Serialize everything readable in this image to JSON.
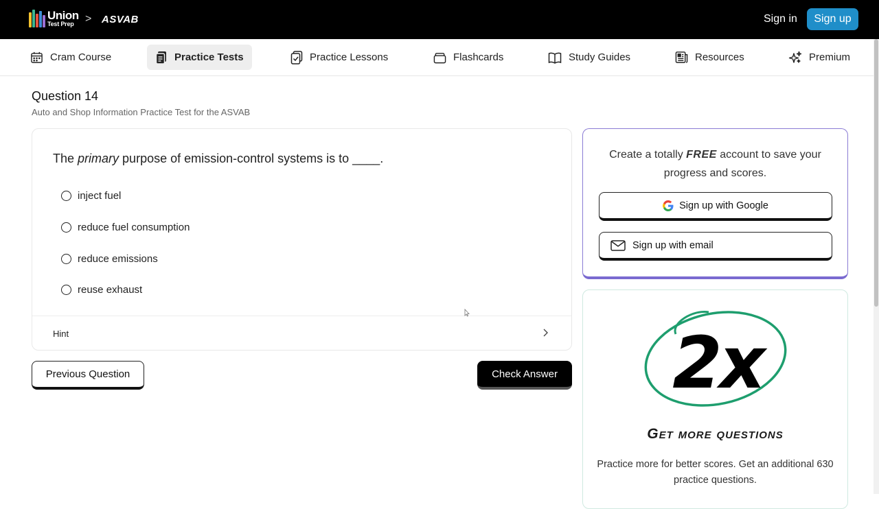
{
  "header": {
    "brand_line1": "Union",
    "brand_line2": "Test Prep",
    "breadcrumb_separator": ">",
    "breadcrumb": "ASVAB",
    "signin_label": "Sign in",
    "signup_label": "Sign up"
  },
  "nav": {
    "items": [
      {
        "label": "Cram Course",
        "icon": "calendar-icon"
      },
      {
        "label": "Practice Tests",
        "icon": "document-stack-icon",
        "active": true
      },
      {
        "label": "Practice Lessons",
        "icon": "clipboard-check-icon"
      },
      {
        "label": "Flashcards",
        "icon": "cards-icon"
      },
      {
        "label": "Study Guides",
        "icon": "open-book-icon"
      },
      {
        "label": "Resources",
        "icon": "newspaper-icon"
      },
      {
        "label": "Premium",
        "icon": "sparkles-icon"
      }
    ]
  },
  "question": {
    "title": "Question 14",
    "subtitle": "Auto and Shop Information Practice Test for the ASVAB",
    "prompt_before": "The ",
    "prompt_emphasis": "primary",
    "prompt_after": " purpose of emission-control systems is to ____.",
    "options": [
      "inject fuel",
      "reduce fuel consumption",
      "reduce emissions",
      "reuse exhaust"
    ],
    "hint_label": "Hint"
  },
  "actions": {
    "previous_label": "Previous Question",
    "check_label": "Check Answer"
  },
  "signup_card": {
    "text_before": "Create a totally ",
    "text_emphasis": "FREE",
    "text_after": " account to save your progress and scores.",
    "google_label": "Sign up with Google",
    "email_label": "Sign up with email"
  },
  "more_card": {
    "badge": "2x",
    "title": "Get more questions",
    "text": "Practice more for better scores. Get an additional 630 practice questions."
  },
  "colors": {
    "accent_blue": "#1f8ec9",
    "promo_border": "#7a6ad0",
    "ring_green": "#1e9e6e"
  }
}
